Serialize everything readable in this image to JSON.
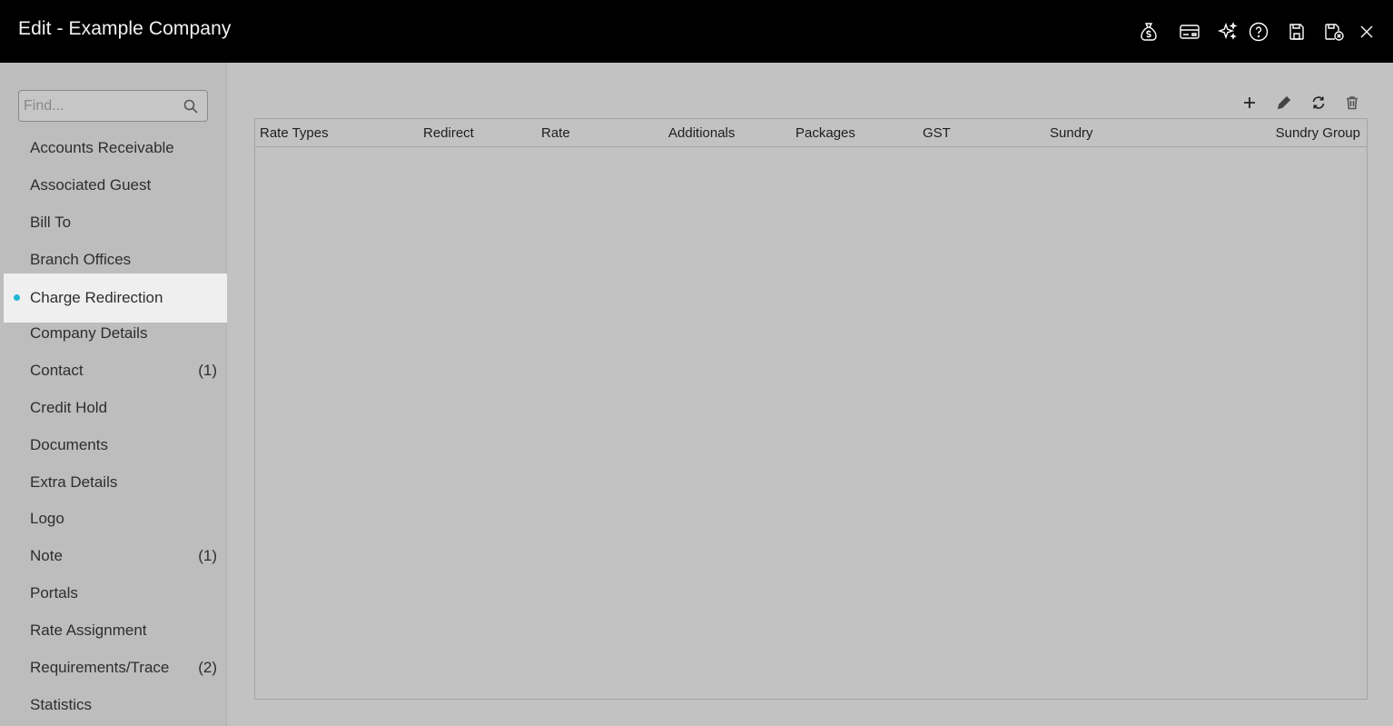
{
  "window": {
    "title": "Edit - Example Company",
    "icons": [
      "money-bag-icon",
      "card-icon",
      "sparkle-icon",
      "help-icon",
      "save-icon",
      "save-close-icon",
      "close-icon"
    ]
  },
  "sidebar": {
    "search_placeholder": "Find...",
    "items": [
      {
        "label": "Accounts Receivable",
        "count": ""
      },
      {
        "label": "Associated Guest",
        "count": ""
      },
      {
        "label": "Bill To",
        "count": ""
      },
      {
        "label": "Branch Offices",
        "count": ""
      },
      {
        "label": "Charge Redirection",
        "count": "",
        "active": true
      },
      {
        "label": "Company Details",
        "count": ""
      },
      {
        "label": "Contact",
        "count": "(1)"
      },
      {
        "label": "Credit Hold",
        "count": ""
      },
      {
        "label": "Documents",
        "count": ""
      },
      {
        "label": "Extra Details",
        "count": ""
      },
      {
        "label": "Logo",
        "count": ""
      },
      {
        "label": "Note",
        "count": "(1)"
      },
      {
        "label": "Portals",
        "count": ""
      },
      {
        "label": "Rate Assignment",
        "count": ""
      },
      {
        "label": "Requirements/Trace",
        "count": "(2)"
      },
      {
        "label": "Statistics",
        "count": ""
      }
    ],
    "accent_color": "#1fb6d2"
  },
  "grid": {
    "toolbar_icons": [
      "add-icon",
      "edit-icon",
      "refresh-icon",
      "delete-icon"
    ],
    "columns": [
      "Rate Types",
      "Redirect",
      "Rate",
      "Additionals",
      "Packages",
      "GST",
      "Sundry",
      "Sundry Group"
    ],
    "rows": []
  }
}
